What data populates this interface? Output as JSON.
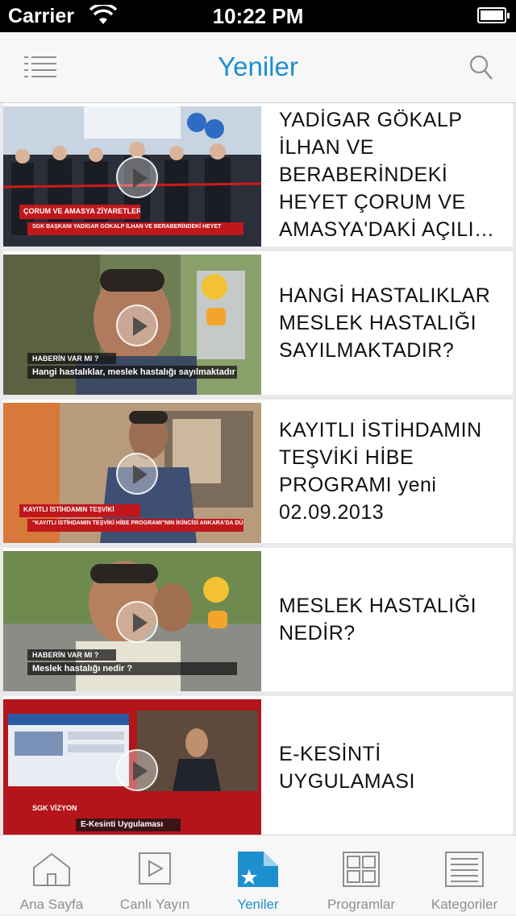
{
  "status_bar": {
    "carrier": "Carrier",
    "time": "10:22 PM",
    "wifi_icon": "wifi-icon",
    "battery_icon": "battery-icon"
  },
  "nav": {
    "title": "Yeniler",
    "menu_icon": "list-menu-icon",
    "search_icon": "search-icon",
    "accent_color": "#1d8fcf"
  },
  "items": [
    {
      "title": "YADİGAR GÖKALP İLHAN VE BERABERİNDEKİ HEYET ÇORUM VE AMASYA'DAKİ AÇILI…",
      "thumb_banner": "ÇORUM VE AMASYA ZİYARETLERİ",
      "thumb_strip": "SGK BAŞKANI YADİGAR GÖKALP İLHAN VE BERABERİNDEKİ HEYET"
    },
    {
      "title": "HANGİ HASTALIKLAR MESLEK HASTALIĞI SAYILMAKTADIR?",
      "thumb_banner": "HABERİN VAR MI ?",
      "thumb_strip": "Hangi hastalıklar, meslek hastalığı sayılmaktadır ?"
    },
    {
      "title": "KAYITLI İSTİHDAMIN TEŞVİKİ HİBE PROGRAMI  yeni 02.09.2013",
      "thumb_banner": "KAYITLI İSTİHDAMIN TEŞVİKİ",
      "thumb_strip": "\"KAYITLI İSTİHDAMIN TEŞVİKİ HİBE PROGRAMI\"NIN İKİNCİSİ ANKARA'DA DÜZENLENDİ"
    },
    {
      "title": "MESLEK HASTALIĞI NEDİR?",
      "thumb_banner": "HABERİN VAR MI ?",
      "thumb_strip": "Meslek hastalığı nedir ?"
    },
    {
      "title": "E-KESİNTİ UYGULAMASI",
      "thumb_banner": "SGK VİZYON",
      "thumb_strip": "E-Kesinti Uygulaması"
    }
  ],
  "tabs": [
    {
      "label": "Ana Sayfa",
      "icon": "home-icon",
      "active": false
    },
    {
      "label": "Canlı Yayın",
      "icon": "play-icon",
      "active": false
    },
    {
      "label": "Yeniler",
      "icon": "new-document-star-icon",
      "active": true
    },
    {
      "label": "Programlar",
      "icon": "grid-icon",
      "active": false
    },
    {
      "label": "Kategoriler",
      "icon": "list-icon",
      "active": false
    }
  ]
}
